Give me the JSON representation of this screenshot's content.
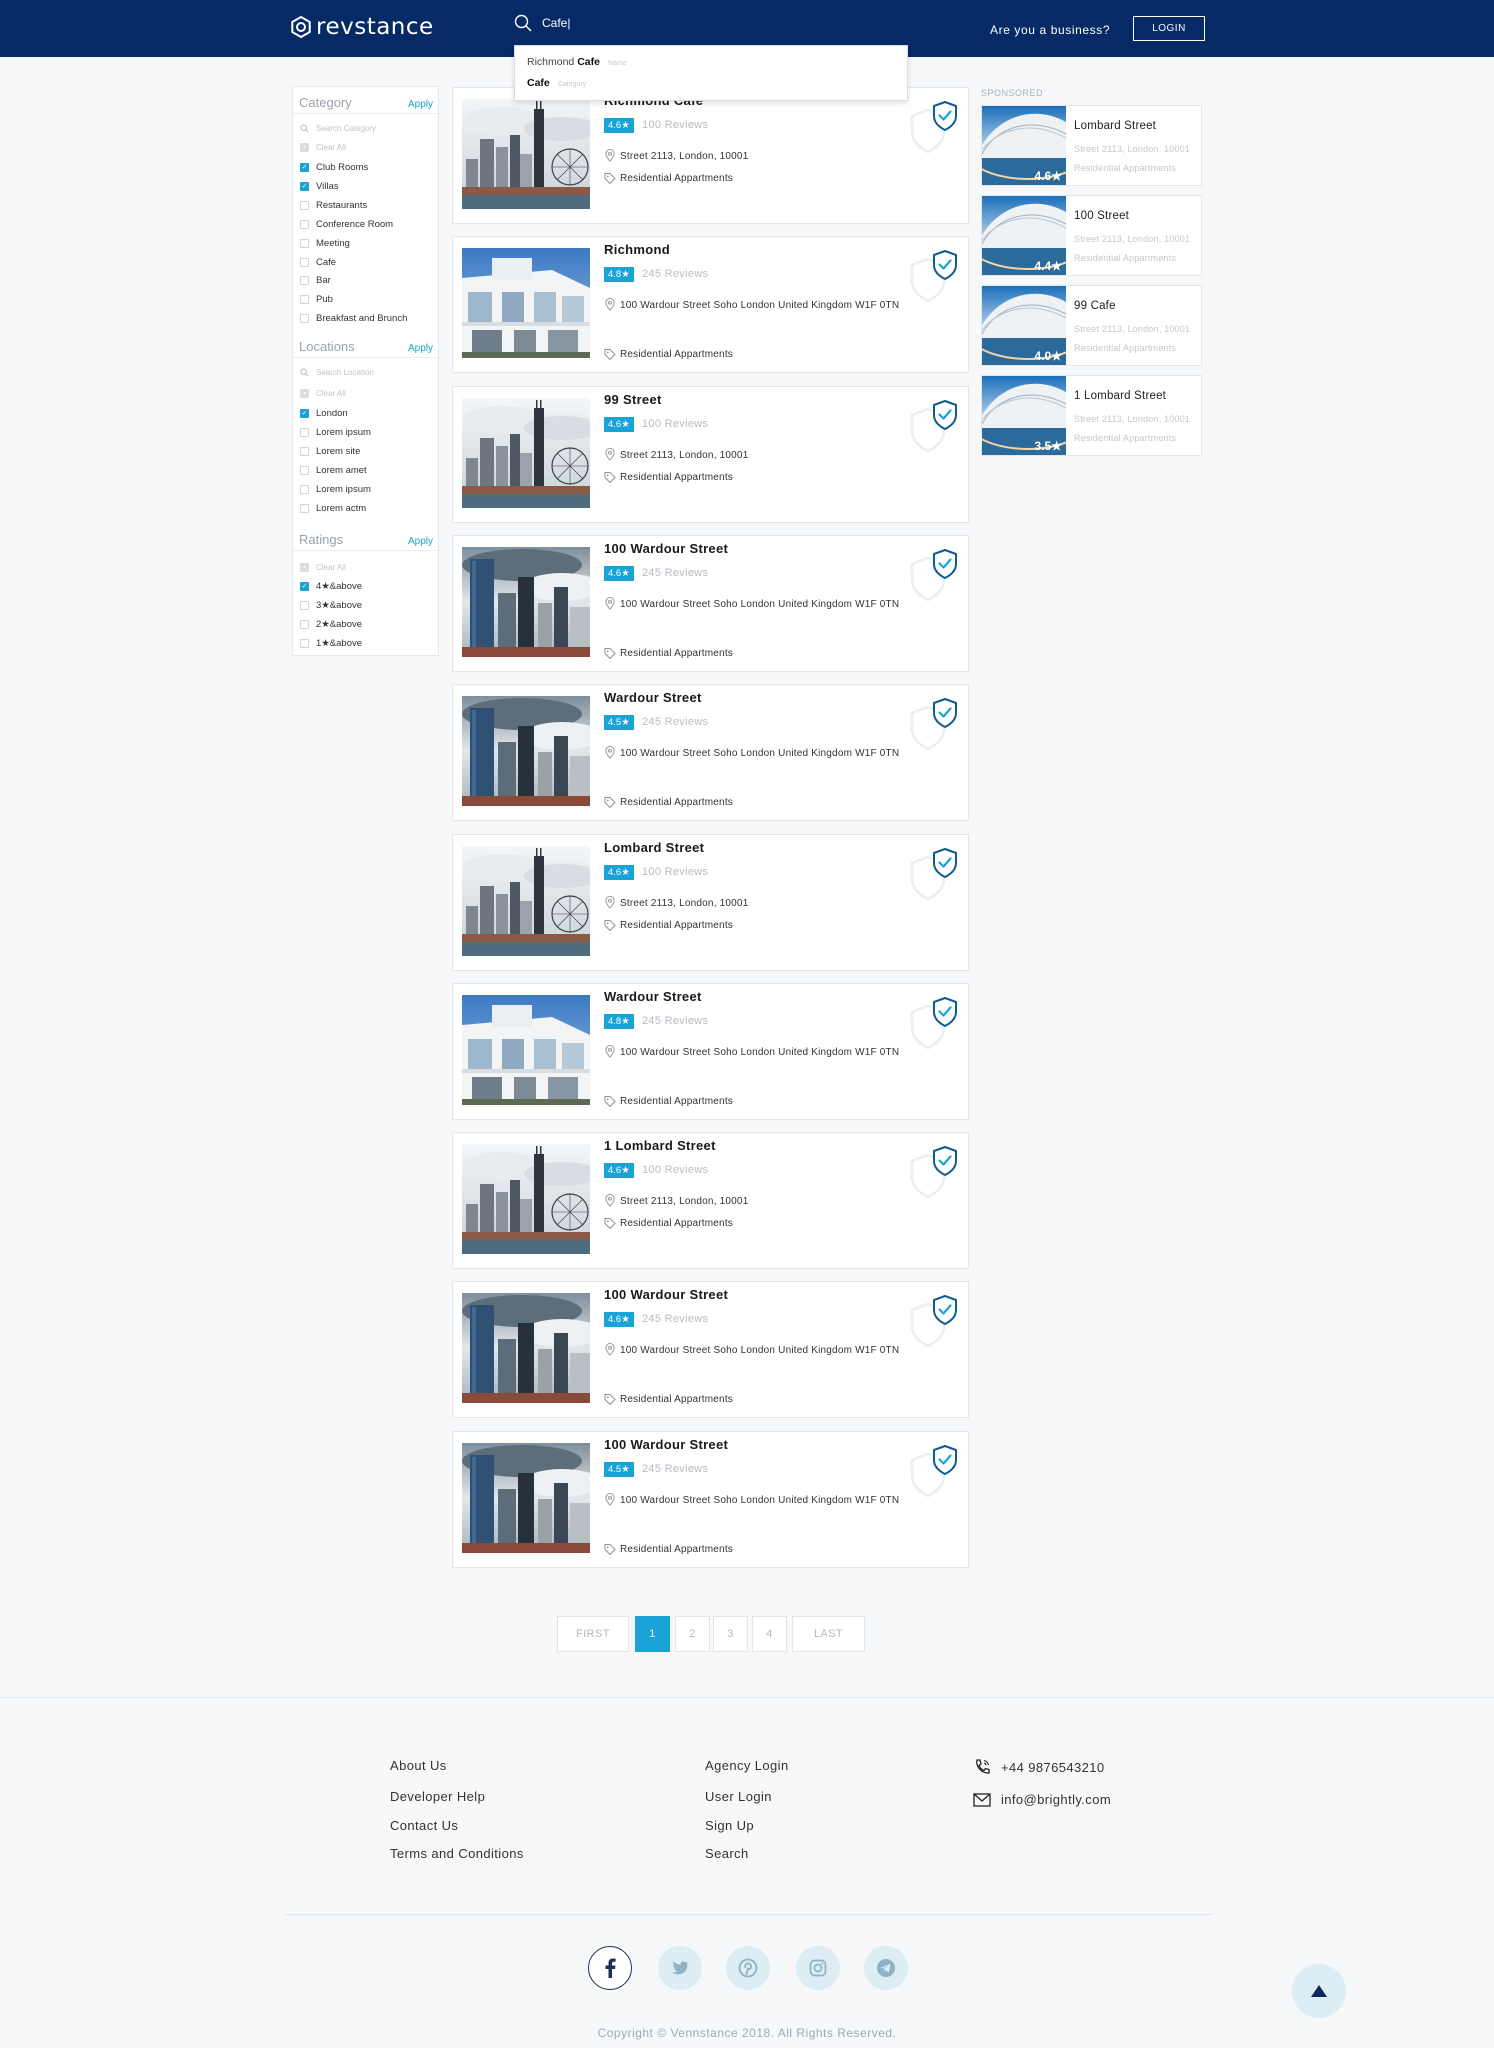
{
  "header": {
    "brand": "revstance",
    "search_value": "Cafe|",
    "business_text": "Are you a business?",
    "login_label": "LOGIN"
  },
  "search_dropdown": [
    {
      "prefix": "Richmond ",
      "match": "Cafe",
      "tag": "Name"
    },
    {
      "prefix": "",
      "match": "Cafe",
      "tag": "Category"
    }
  ],
  "filters": {
    "category": {
      "title": "Category",
      "apply": "Apply",
      "search_placeholder": "Search Category",
      "clear": "Clear All",
      "options": [
        {
          "label": "Club Rooms",
          "checked": true
        },
        {
          "label": "Villas",
          "checked": true
        },
        {
          "label": "Restaurants",
          "checked": false
        },
        {
          "label": "Conference Room",
          "checked": false
        },
        {
          "label": "Meeting",
          "checked": false
        },
        {
          "label": "Cafe",
          "checked": false
        },
        {
          "label": "Bar",
          "checked": false
        },
        {
          "label": "Pub",
          "checked": false
        },
        {
          "label": "Breakfast and Brunch",
          "checked": false
        }
      ]
    },
    "locations": {
      "title": "Locations",
      "apply": "Apply",
      "search_placeholder": "Search Location",
      "clear": "Clear All",
      "options": [
        {
          "label": "London",
          "checked": true
        },
        {
          "label": "Lorem ipsum",
          "checked": false
        },
        {
          "label": "Lorem site",
          "checked": false
        },
        {
          "label": "Lorem amet",
          "checked": false
        },
        {
          "label": "Lorem ipsum",
          "checked": false
        },
        {
          "label": "Lorem actm",
          "checked": false
        }
      ]
    },
    "ratings": {
      "title": "Ratings",
      "apply": "Apply",
      "clear": "Clear All",
      "options": [
        {
          "label": "4★&above",
          "checked": true
        },
        {
          "label": "3★&above",
          "checked": false
        },
        {
          "label": "2★&above",
          "checked": false
        },
        {
          "label": "1★&above",
          "checked": false
        }
      ]
    }
  },
  "listings": [
    {
      "title": "Richmond Cafe",
      "rating": "4.6★",
      "reviews": "100 Reviews",
      "address": "Street 2113, London, 10001",
      "type": "Residential Appartments",
      "image": "tower"
    },
    {
      "title": "Richmond",
      "rating": "4.8★",
      "reviews": "245 Reviews",
      "address": "100 Wardour Street Soho London United Kingdom W1F 0TN",
      "type": "Residential Appartments",
      "image": "house"
    },
    {
      "title": "99 Street",
      "rating": "4.6★",
      "reviews": "100 Reviews",
      "address": "Street 2113, London, 10001",
      "type": "Residential Appartments",
      "image": "tower"
    },
    {
      "title": "100 Wardour Street",
      "rating": "4.6★",
      "reviews": "245 Reviews",
      "address": "100 Wardour Street Soho London United Kingdom W1F 0TN",
      "type": "Residential Appartments",
      "image": "skyline"
    },
    {
      "title": " Wardour Street",
      "rating": "4.5★",
      "reviews": "245 Reviews",
      "address": "100 Wardour Street Soho London United Kingdom W1F 0TN",
      "type": "Residential Appartments",
      "image": "skyline"
    },
    {
      "title": "Lombard Street",
      "rating": "4.6★",
      "reviews": "100 Reviews",
      "address": "Street 2113, London, 10001",
      "type": "Residential Appartments",
      "image": "tower"
    },
    {
      "title": "Wardour Street",
      "rating": "4.8★",
      "reviews": "245 Reviews",
      "address": "100 Wardour Street Soho London United Kingdom W1F 0TN",
      "type": "Residential Appartments",
      "image": "house"
    },
    {
      "title": "1 Lombard Street",
      "rating": "4.6★",
      "reviews": "100 Reviews",
      "address": "Street 2113, London, 10001",
      "type": "Residential Appartments",
      "image": "tower"
    },
    {
      "title": "100 Wardour Street",
      "rating": "4.6★",
      "reviews": "245 Reviews",
      "address": "100 Wardour Street Soho London United Kingdom W1F 0TN",
      "type": "Residential Appartments",
      "image": "skyline"
    },
    {
      "title": "100 Wardour Street",
      "rating": "4.5★",
      "reviews": "245 Reviews",
      "address": "100 Wardour Street Soho London United Kingdom W1F 0TN",
      "type": "Residential Appartments",
      "image": "skyline"
    }
  ],
  "sponsored": {
    "label": "SPONSORED",
    "items": [
      {
        "title": "Lombard Street",
        "rating": "4.6★",
        "address": "Street 2113, London, 10001",
        "type": "Residential Appartments"
      },
      {
        "title": "100 Street",
        "rating": "4.4★",
        "address": "Street 2113, London, 10001",
        "type": "Residential Appartments"
      },
      {
        "title": "99 Cafe",
        "rating": "4.0★",
        "address": "Street 2113, London, 10001",
        "type": "Residential Appartments"
      },
      {
        "title": "1 Lombard Street",
        "rating": "3.5★",
        "address": "Street 2113, London, 10001",
        "type": "Residential Appartments"
      }
    ]
  },
  "pagination": {
    "first": "FIRST",
    "pages": [
      "1",
      "2",
      "3",
      "4"
    ],
    "active": "1",
    "last": "LAST"
  },
  "footer": {
    "col1": [
      "About Us",
      "Developer Help",
      "Contact Us",
      "Terms and Conditions"
    ],
    "col2": [
      "Agency Login",
      "User Login",
      "Sign Up",
      "Search"
    ],
    "phone": "+44 9876543210",
    "email": "info@brightly.com",
    "social": [
      "facebook-icon",
      "twitter-icon",
      "pinterest-icon",
      "instagram-icon",
      "telegram-icon"
    ],
    "copyright": "Copyright © Vennstance 2018. All Rights Reserved."
  },
  "colors": {
    "header_bg": "#062a66",
    "accent": "#19a3d6"
  }
}
